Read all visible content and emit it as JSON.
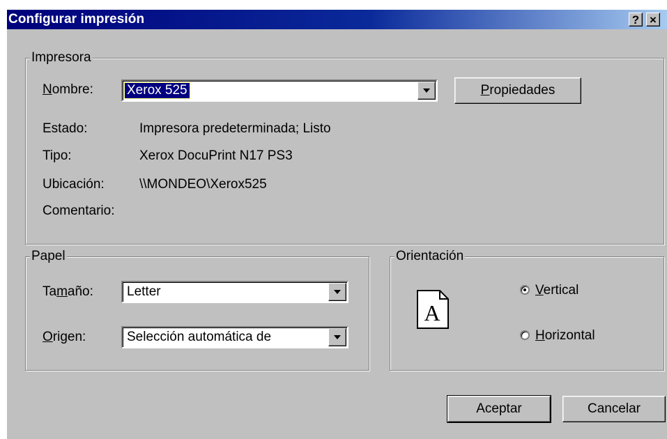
{
  "window": {
    "title": "Configurar impresión",
    "help_glyph": "?",
    "close_glyph": "×"
  },
  "printer": {
    "legend": "Impresora",
    "name_label": "Nombre:",
    "name_value": "Xerox 525",
    "properties_button": "Propiedades",
    "status_label": "Estado:",
    "status_value": "Impresora predeterminada; Listo",
    "type_label": "Tipo:",
    "type_value": "Xerox DocuPrint N17 PS3",
    "location_label": "Ubicación:",
    "location_value": "\\\\MONDEO\\Xerox525",
    "comment_label": "Comentario:",
    "comment_value": ""
  },
  "paper": {
    "legend": "Papel",
    "size_label": "Tamaño:",
    "size_value": "Letter",
    "source_label": "Origen:",
    "source_value": "Selección automática de"
  },
  "orientation": {
    "legend": "Orientación",
    "icon_letter": "A",
    "options": [
      {
        "label": "Vertical",
        "selected": true
      },
      {
        "label": "Horizontal",
        "selected": false
      }
    ]
  },
  "buttons": {
    "ok": "Aceptar",
    "cancel": "Cancelar"
  },
  "icons": {
    "help": "help-icon",
    "close": "close-icon",
    "page": "portrait-page-icon",
    "dropdown": "chevron-down-icon"
  }
}
